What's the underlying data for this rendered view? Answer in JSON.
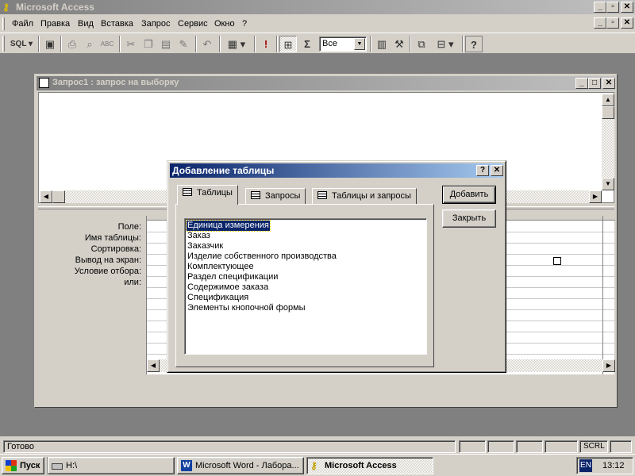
{
  "app": {
    "title": "Microsoft Access",
    "caption_buttons": [
      "_",
      "▫",
      "✕"
    ]
  },
  "menu": [
    "Файл",
    "Правка",
    "Вид",
    "Вставка",
    "Запрос",
    "Сервис",
    "Окно",
    "?"
  ],
  "toolbar": {
    "sql_label": "SQL",
    "top_values": "Все",
    "sigma": "Σ",
    "bang": "!",
    "help": "?"
  },
  "query_window": {
    "title": "Запрос1 : запрос на выборку",
    "row_labels": [
      "Поле:",
      "Имя таблицы:",
      "Сортировка:",
      "Вывод на экран:",
      "Условие отбора:",
      "или:"
    ]
  },
  "dialog": {
    "title": "Добавление таблицы",
    "help": "?",
    "close": "✕",
    "tabs": [
      "Таблицы",
      "Запросы",
      "Таблицы и запросы"
    ],
    "add_button": "Добавить",
    "close_button": "Закрыть",
    "items": [
      "Единица измерения",
      "Заказ",
      "Заказчик",
      "Изделие собственного производства",
      "Комплектующее",
      "Раздел спецификации",
      "Содержимое заказа",
      "Спецификация",
      "Элементы кнопочной формы"
    ],
    "selected_index": 0
  },
  "status": {
    "text": "Готово",
    "scrl": "SCRL"
  },
  "taskbar": {
    "start": "Пуск",
    "buttons": [
      "H:\\",
      "Microsoft Word - Лабора...",
      "Microsoft Access"
    ],
    "lang": "EN",
    "clock": "13:12"
  }
}
